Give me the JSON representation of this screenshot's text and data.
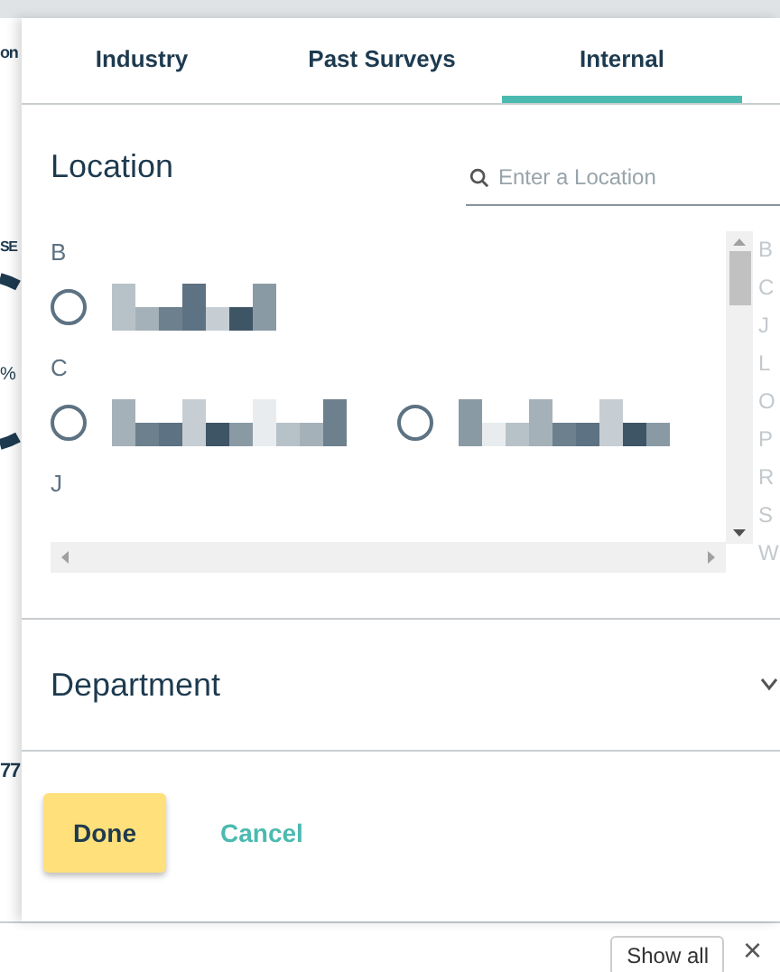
{
  "background": {
    "texts": [
      "on",
      "SE",
      "%",
      "77"
    ],
    "bottom_bar": {
      "show_all": "Show all",
      "close": "×"
    }
  },
  "tabs": [
    {
      "label": "Industry",
      "selected": false
    },
    {
      "label": "Past Surveys",
      "selected": false
    },
    {
      "label": "Internal",
      "selected": true
    }
  ],
  "location": {
    "title": "Location",
    "search": {
      "placeholder": "Enter a Location"
    },
    "groups": [
      {
        "letter": "B",
        "options": [
          {
            "selected": false
          }
        ]
      },
      {
        "letter": "C",
        "options": [
          {
            "selected": false
          },
          {
            "selected": false
          }
        ]
      },
      {
        "letter": "J"
      }
    ],
    "index": [
      "B",
      "C",
      "J",
      "L",
      "O",
      "P",
      "R",
      "S",
      "W"
    ]
  },
  "department": {
    "title": "Department",
    "expanded": false
  },
  "buttons": {
    "done": "Done",
    "cancel": "Cancel"
  }
}
